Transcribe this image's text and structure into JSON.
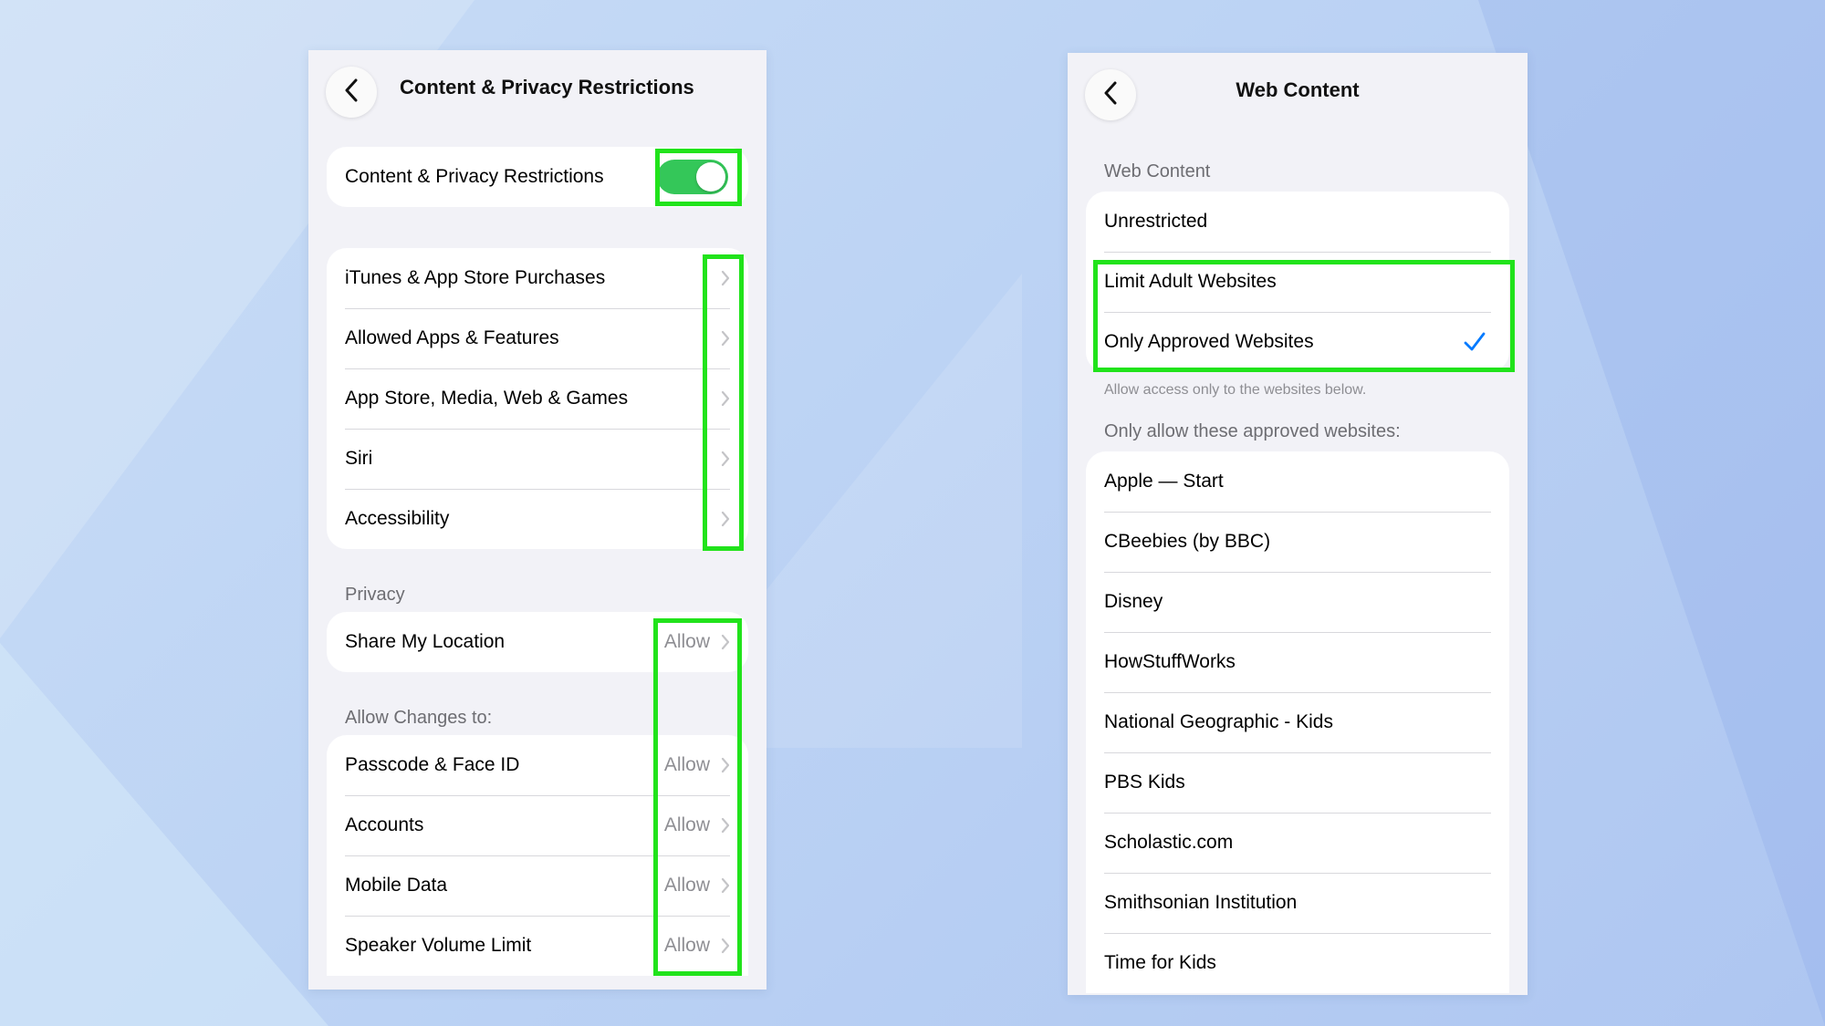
{
  "left": {
    "title": "Content & Privacy Restrictions",
    "toggle_row": {
      "label": "Content & Privacy Restrictions",
      "toggle_on": true
    },
    "menu_items": [
      {
        "label": "iTunes & App Store Purchases"
      },
      {
        "label": "Allowed Apps & Features"
      },
      {
        "label": "App Store, Media, Web & Games"
      },
      {
        "label": "Siri"
      },
      {
        "label": "Accessibility"
      }
    ],
    "privacy_header": "Privacy",
    "privacy_items": [
      {
        "label": "Share My Location",
        "value": "Allow"
      }
    ],
    "changes_header": "Allow Changes to:",
    "changes_items": [
      {
        "label": "Passcode & Face ID",
        "value": "Allow"
      },
      {
        "label": "Accounts",
        "value": "Allow"
      },
      {
        "label": "Mobile Data",
        "value": "Allow"
      },
      {
        "label": "Speaker Volume Limit",
        "value": "Allow"
      }
    ]
  },
  "right": {
    "title": "Web Content",
    "web_header": "Web Content",
    "options": [
      {
        "label": "Unrestricted"
      },
      {
        "label": "Limit Adult Websites"
      },
      {
        "label": "Only Approved Websites",
        "selected": true
      }
    ],
    "options_footer": "Allow access only to the websites below.",
    "sites_header": "Only allow these approved websites:",
    "sites": [
      {
        "label": "Apple — Start"
      },
      {
        "label": "CBeebies (by BBC)"
      },
      {
        "label": "Disney"
      },
      {
        "label": "HowStuffWorks"
      },
      {
        "label": "National Geographic - Kids"
      },
      {
        "label": "PBS Kids"
      },
      {
        "label": "Scholastic.com"
      },
      {
        "label": "Smithsonian Institution"
      },
      {
        "label": "Time for Kids"
      }
    ]
  },
  "icons": {
    "back": "chevron-left-icon",
    "disclosure": "chevron-right-icon",
    "selected": "checkmark-icon"
  },
  "colors": {
    "toggle_on": "#34c759",
    "checkmark": "#007aff",
    "highlight": "#21e31b",
    "background": "#f2f2f7"
  }
}
